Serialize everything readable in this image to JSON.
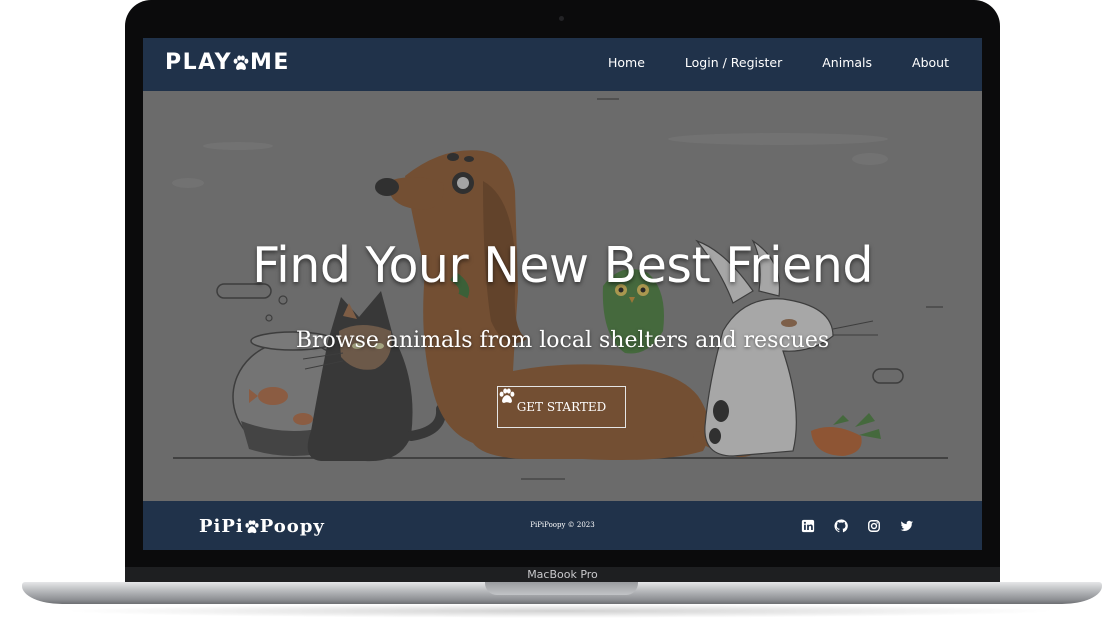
{
  "laptop": {
    "chin_label": "MacBook Pro"
  },
  "navbar": {
    "logo_left": "PLAY",
    "logo_right": "ME",
    "links": [
      "Home",
      "Login / Register",
      "Animals",
      "About"
    ]
  },
  "hero": {
    "title": "Find Your New Best Friend",
    "subtitle": "Browse animals from local shelters and rescues",
    "cta_label": "GET STARTED"
  },
  "footer": {
    "brand_left": "PiPi",
    "brand_right": "Poopy",
    "copyright": "PiPiPoopy © 2023",
    "social_icons": [
      "linkedin-icon",
      "github-icon",
      "instagram-icon",
      "twitter-icon"
    ]
  },
  "colors": {
    "navbar_bg": "#20324a",
    "hero_overlay": "#6b6b6b",
    "text": "#ffffff"
  }
}
